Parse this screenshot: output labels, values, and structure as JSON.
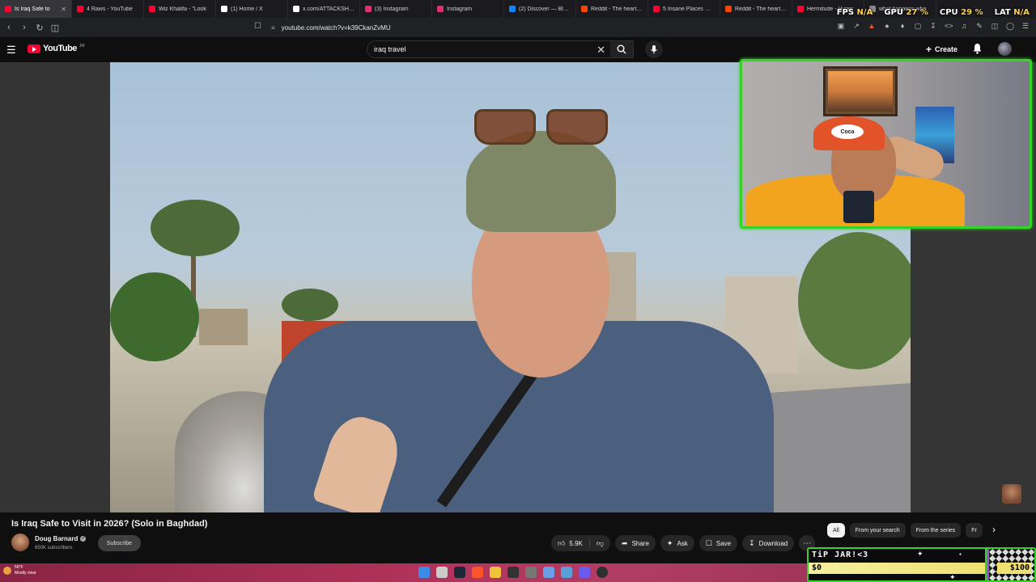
{
  "browser": {
    "tabs": [
      {
        "title": "Is Iraq Safe to",
        "color": "#ff0033",
        "active": true
      },
      {
        "title": "4 Raws - YouTube",
        "color": "#ff0033",
        "active": false
      },
      {
        "title": "Wiz Khalifa - \"Look",
        "color": "#ff0033",
        "active": false
      },
      {
        "title": "(1) Home / X",
        "color": "#ffffff",
        "active": false
      },
      {
        "title": "x.com/ATTACKSHARK",
        "color": "#ffffff",
        "active": false
      },
      {
        "title": "(3) Instagram",
        "color": "#e1306c",
        "active": false
      },
      {
        "title": "Instagram",
        "color": "#e1306c",
        "active": false
      },
      {
        "title": "(2) Discover — Blues",
        "color": "#1185fe",
        "active": false
      },
      {
        "title": "Reddit - The heart of",
        "color": "#ff4500",
        "active": false
      },
      {
        "title": "5 Insane Places Whe",
        "color": "#ff0033",
        "active": false
      },
      {
        "title": "Reddit - The heart of",
        "color": "#ff4500",
        "active": false
      },
      {
        "title": "Hermitude - Hyper",
        "color": "#ff0033",
        "active": false
      },
      {
        "title": "what happens whe",
        "color": "#888888",
        "active": false
      }
    ],
    "url": "youtube.com/watch?v=k39CkanZvMU"
  },
  "perf_overlay": {
    "fps_label": "FPS",
    "fps_value": "N/A",
    "gpu_label": "GPU",
    "gpu_value": "27 %",
    "cpu_label": "CPU",
    "cpu_value": "29 %",
    "lat_label": "LAT",
    "lat_value": "N/A"
  },
  "youtube": {
    "logo_text": "YouTube",
    "logo_country": "JM",
    "search_value": "iraq travel",
    "create_label": "Create"
  },
  "video": {
    "title": "Is Iraq Safe to Visit in 2026? (Solo in Baghdad)",
    "channel": "Doug Barnard",
    "subscribers": "650K subscribers",
    "subscribe_label": "Subscribe",
    "likes": "5.9K",
    "share_label": "Share",
    "ask_label": "Ask",
    "save_label": "Save",
    "download_label": "Download",
    "webcam_hat_text": "Coca"
  },
  "chips": [
    "All",
    "From your search",
    "From the series",
    "Fr"
  ],
  "taskbar": {
    "temp": "56°F",
    "weather": "Mostly clear"
  },
  "tipjar": {
    "label": "TiP JAR!<3",
    "current": "$0",
    "goal": "$100",
    "progress": 0
  },
  "colors": {
    "accent_green": "#35d22a",
    "youtube_red": "#ff0033",
    "taskbar": "#b1325a"
  }
}
